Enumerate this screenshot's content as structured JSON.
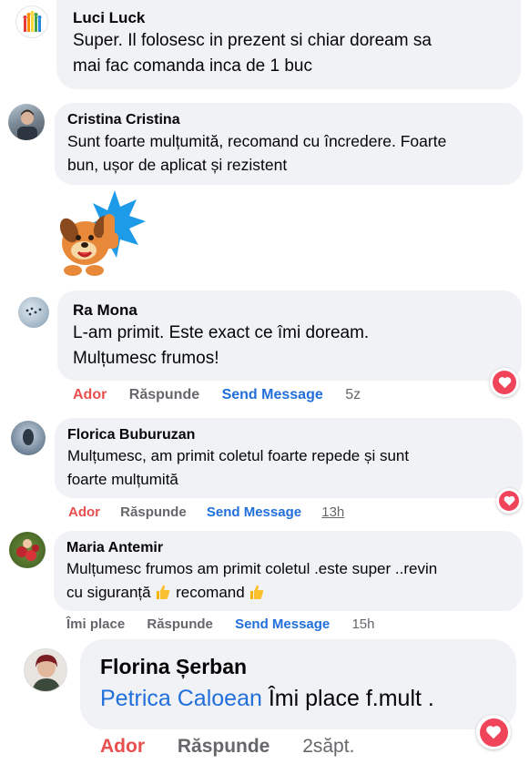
{
  "colors": {
    "bubble": "#f0f2f5",
    "love": "#e94f4f",
    "link": "#216fdb",
    "muted": "#65676b",
    "heart": "#f0445a"
  },
  "comments": [
    {
      "name": "Luci Luck",
      "text_line1": "Super. Il folosesc in prezent si chiar doream sa",
      "text_line2": "mai fac comanda inca de 1 buc",
      "avatar_icon": "colorful-figures-avatar"
    },
    {
      "name": "Cristina Cristina",
      "text_line1": "Sunt foarte mulțumită, recomand cu încredere. Foarte",
      "text_line2": "bun, ușor de aplicat și rezistent",
      "sticker_icon": "dog-thumbs-up-sticker"
    },
    {
      "name": "Ra Mona",
      "text_line1": "L-am primit. Este exact ce îmi doream.",
      "text_line2": "Mulțumesc frumos!",
      "reaction": "Ador",
      "reply": "Răspunde",
      "message": "Send Message",
      "time": "5z"
    },
    {
      "name": "Florica Buburuzan",
      "text_line1": "Mulțumesc, am primit coletul foarte repede și sunt",
      "text_line2": "foarte mulțumită",
      "reaction": "Ador",
      "reply": "Răspunde",
      "message": "Send Message",
      "time": "13h"
    },
    {
      "name": "Maria Antemir",
      "text_line1": "Mulțumesc frumos am primit coletul .este super ..revin",
      "text_line2a": "cu siguranță",
      "text_line2b": "recomand",
      "reaction": "Îmi place",
      "reply": "Răspunde",
      "message": "Send Message",
      "time": "15h"
    },
    {
      "name": "Florina Șerban",
      "tag": "Petrica Caloean",
      "text": " Îmi place f.mult .",
      "reaction": "Ador",
      "reply": "Răspunde",
      "time": "2săpt."
    }
  ]
}
